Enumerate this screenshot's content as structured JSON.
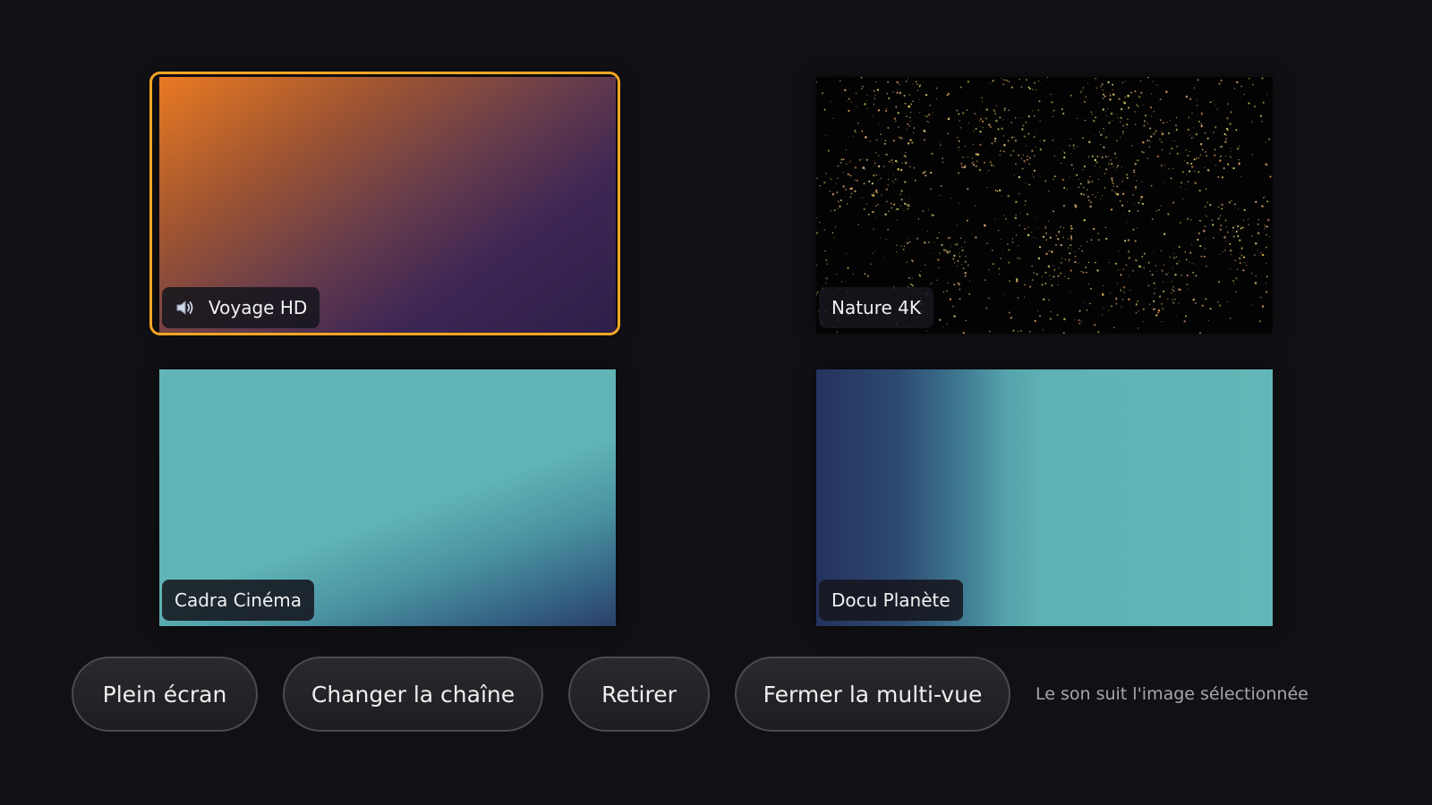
{
  "tiles": [
    {
      "channel": "Voyage HD",
      "audio_active": true,
      "selected": true,
      "audio_icon": "speaker-icon"
    },
    {
      "channel": "Nature 4K",
      "audio_active": false,
      "selected": false
    },
    {
      "channel": "Cadra Cinéma",
      "audio_active": false,
      "selected": false
    },
    {
      "channel": "Docu Planète",
      "audio_active": false,
      "selected": false
    }
  ],
  "controls": {
    "fullscreen_label": "Plein écran",
    "change_channel_label": "Changer la chaîne",
    "remove_label": "Retirer",
    "close_multiview_label": "Fermer la multi-vue",
    "audio_hint": "Le son suit l'image sélectionnée"
  },
  "colors": {
    "focus": "#f5a623",
    "background": "#111014"
  }
}
